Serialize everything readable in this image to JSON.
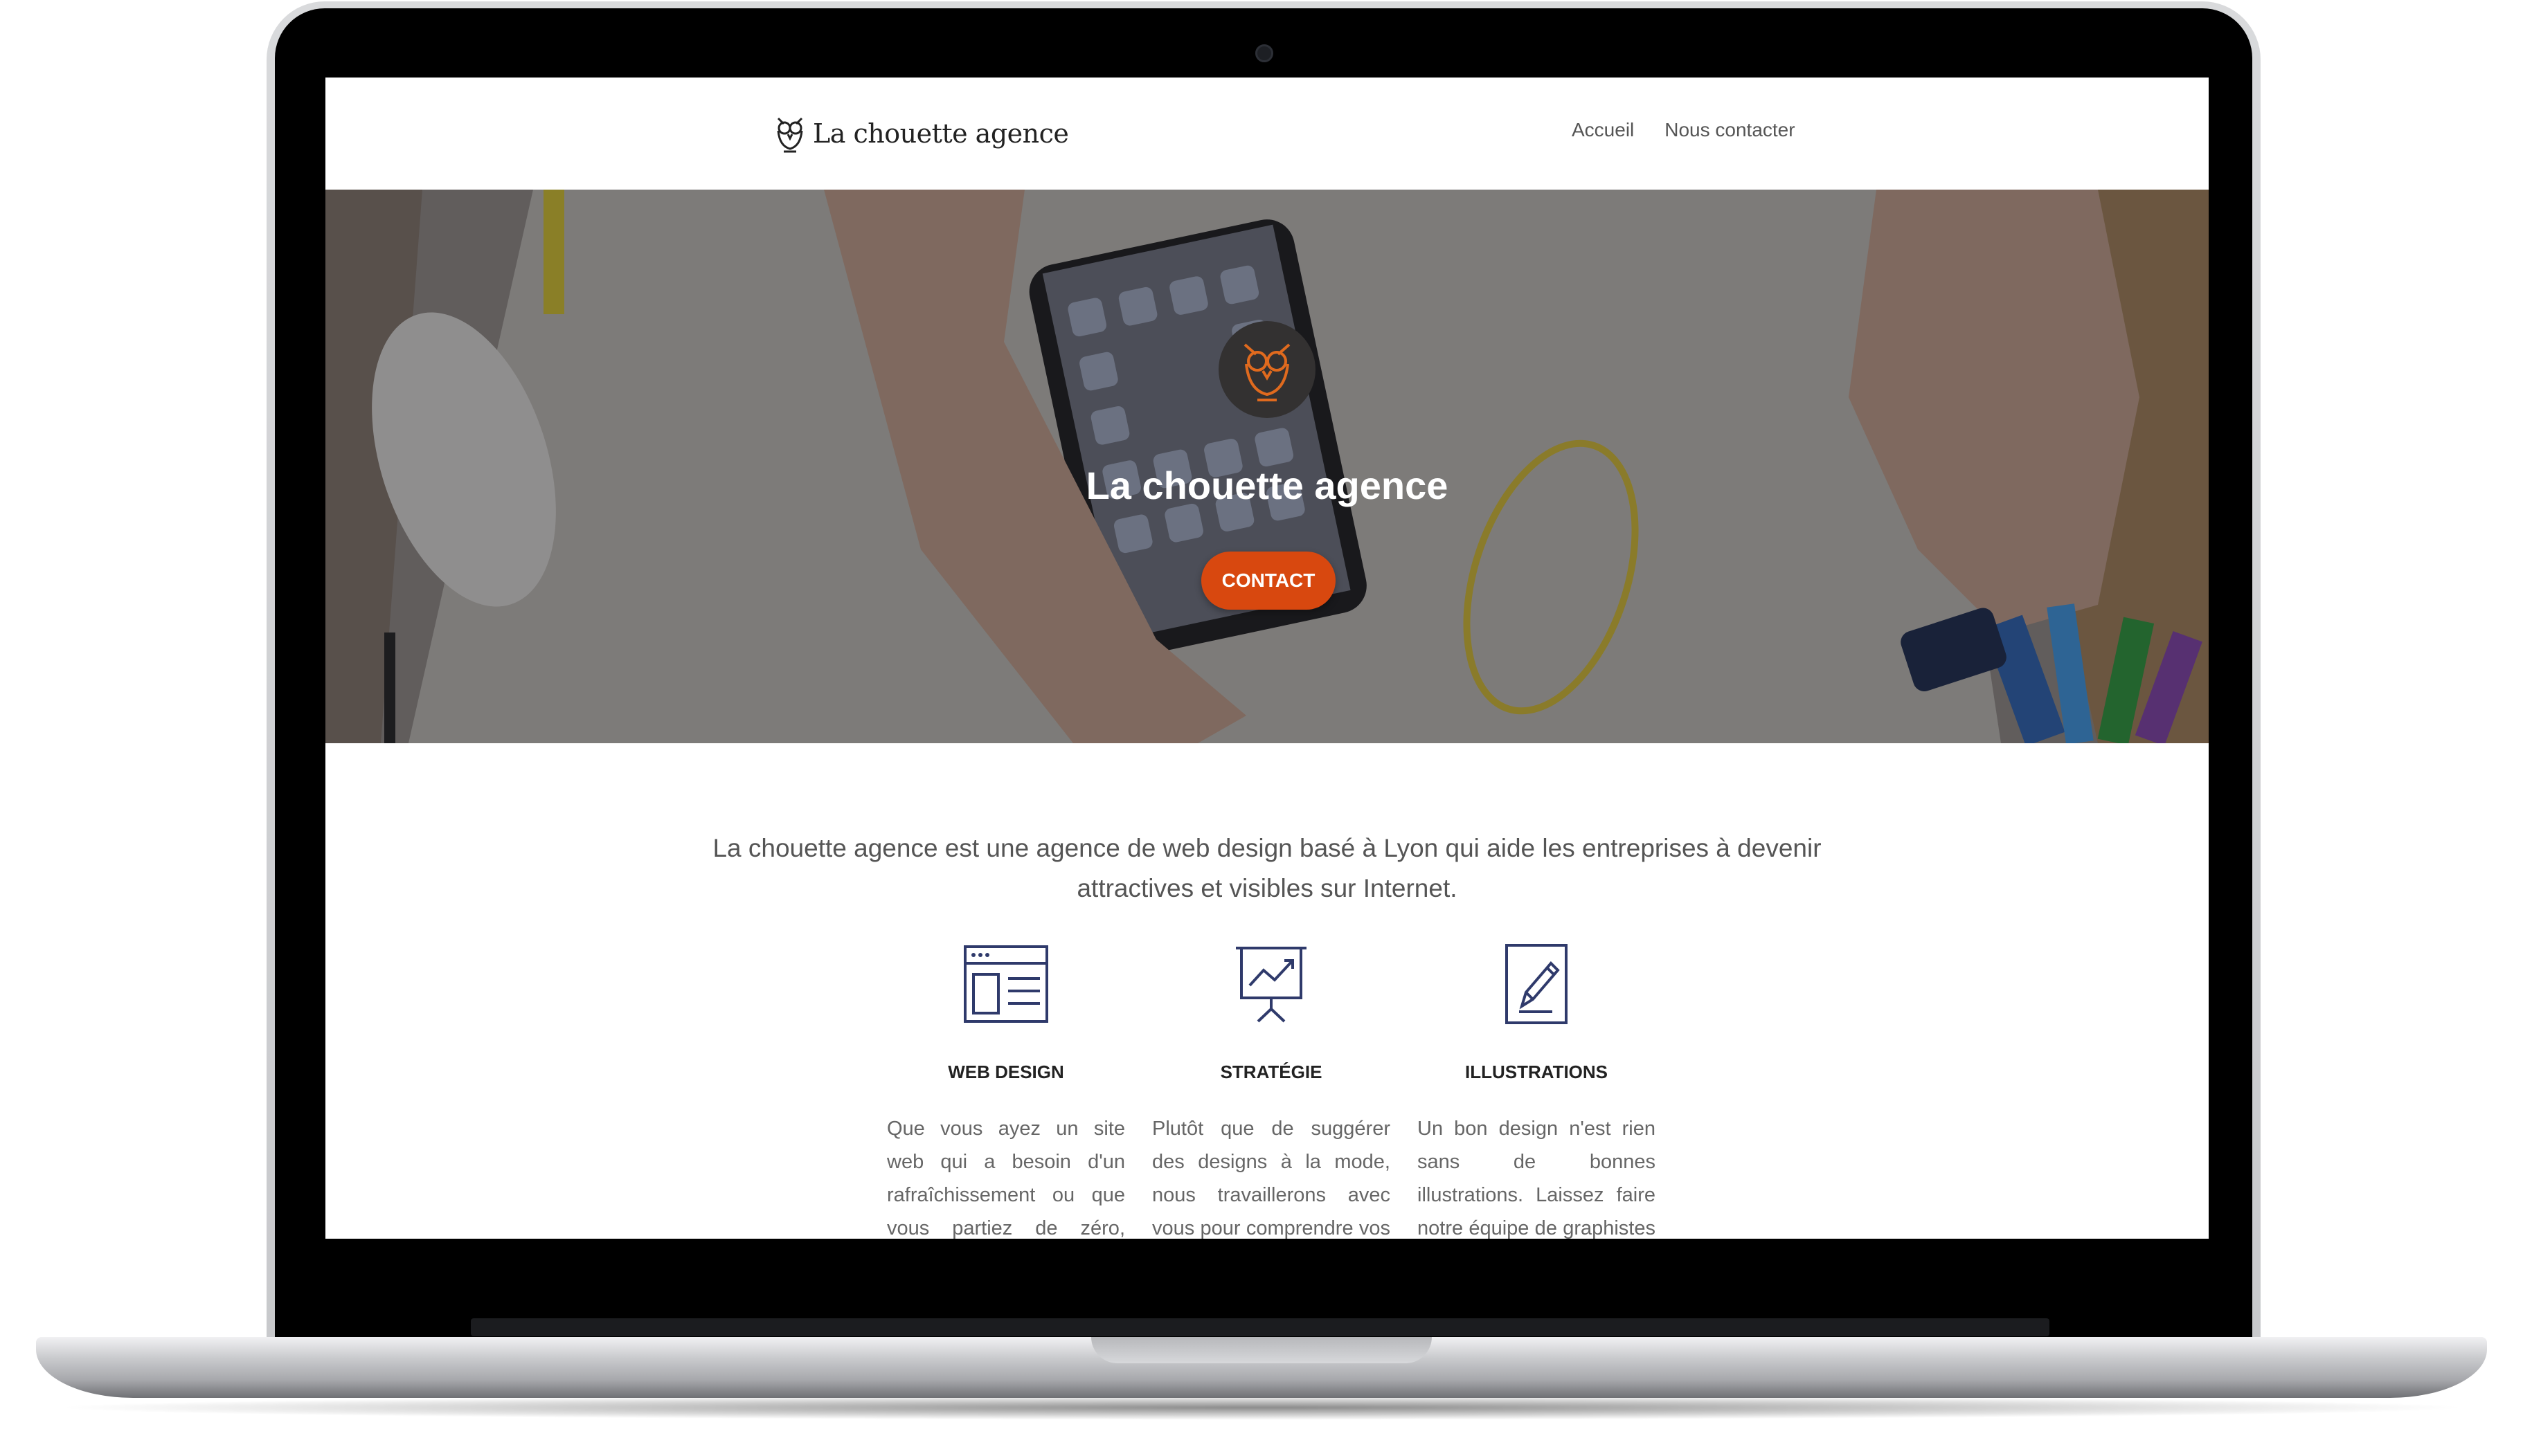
{
  "nav": {
    "brand": "La chouette agence",
    "links": [
      "Accueil",
      "Nous contacter"
    ]
  },
  "hero": {
    "title": "La chouette agence",
    "cta_label": "CONTACT"
  },
  "intro": {
    "line1": "La chouette agence est une agence de web design basé à Lyon qui aide les entreprises à devenir",
    "line2": "attractives et visibles sur Internet."
  },
  "services": [
    {
      "icon": "web-design-icon",
      "title": "WEB DESIGN",
      "text": "Que vous ayez un site web qui a besoin d'un rafraîchissement ou que vous partiez de zéro, laissez-"
    },
    {
      "icon": "strategy-chart-icon",
      "title": "STRATÉGIE",
      "text": "Plutôt que de suggérer des designs à la mode, nous travaillerons avec vous pour comprendre vos objectifs"
    },
    {
      "icon": "pencil-illustration-icon",
      "title": "ILLUSTRATIONS",
      "text": "Un bon design n'est rien sans de bonnes illustrations. Laissez faire notre équipe de graphistes talentueux pour"
    }
  ],
  "colors": {
    "accent": "#d8480f",
    "icon_stroke": "#2f3a6b"
  }
}
